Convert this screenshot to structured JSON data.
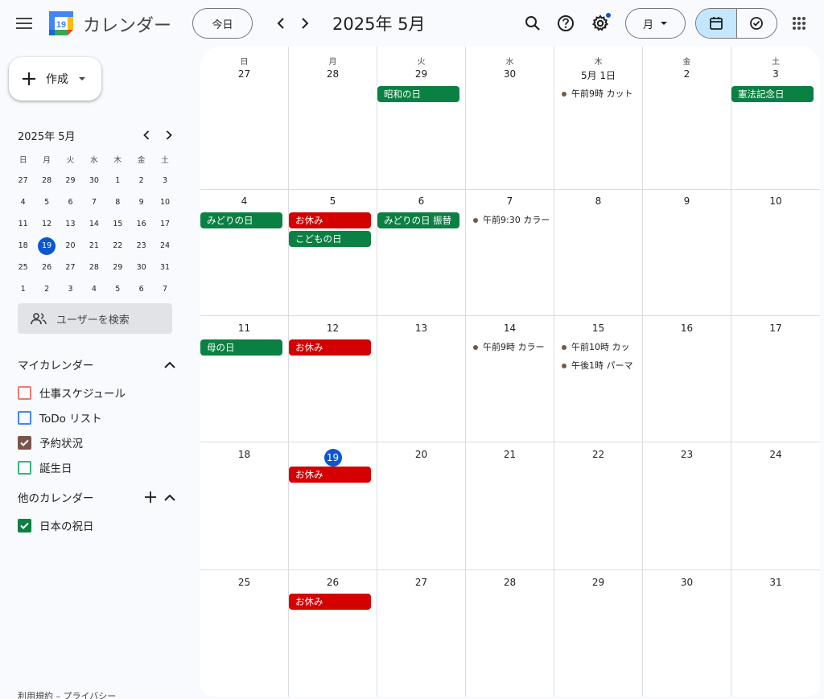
{
  "header": {
    "app_title": "カレンダー",
    "logo_day": "19",
    "today_label": "今日",
    "period_label": "2025年 5月",
    "view_label": "月"
  },
  "sidebar": {
    "create_label": "作成",
    "mini_title": "2025年 5月",
    "weekdays": [
      "日",
      "月",
      "火",
      "水",
      "木",
      "金",
      "土"
    ],
    "mini_days": [
      [
        "27",
        "28",
        "29",
        "30",
        "1",
        "2",
        "3"
      ],
      [
        "4",
        "5",
        "6",
        "7",
        "8",
        "9",
        "10"
      ],
      [
        "11",
        "12",
        "13",
        "14",
        "15",
        "16",
        "17"
      ],
      [
        "18",
        "19",
        "20",
        "21",
        "22",
        "23",
        "24"
      ],
      [
        "25",
        "26",
        "27",
        "28",
        "29",
        "30",
        "31"
      ],
      [
        "1",
        "2",
        "3",
        "4",
        "5",
        "6",
        "7"
      ]
    ],
    "today_day": "19",
    "user_search_label": "ユーザーを検索",
    "my_calendars_title": "マイカレンダー",
    "my_calendars": [
      {
        "label": "仕事スケジュール",
        "color": "#e67c73",
        "checked": false
      },
      {
        "label": "ToDo リスト",
        "color": "#4285f4",
        "checked": false
      },
      {
        "label": "予約状況",
        "color": "#795548",
        "checked": true
      },
      {
        "label": "誕生日",
        "color": "#33b679",
        "checked": false
      }
    ],
    "other_calendars_title": "他のカレンダー",
    "other_calendars": [
      {
        "label": "日本の祝日",
        "color": "#0b8043",
        "checked": true
      }
    ],
    "footer": "利用規約 – プライバシー"
  },
  "month": {
    "weekdays": [
      "日",
      "月",
      "火",
      "水",
      "木",
      "金",
      "土"
    ],
    "weeks": [
      [
        {
          "day": "27",
          "events": []
        },
        {
          "day": "28",
          "events": []
        },
        {
          "day": "29",
          "events": [
            {
              "type": "allday",
              "color": "green",
              "label": "昭和の日"
            }
          ]
        },
        {
          "day": "30",
          "events": []
        },
        {
          "day": "5月 1日",
          "events": [
            {
              "type": "timed",
              "label": "午前9時 カット"
            }
          ]
        },
        {
          "day": "2",
          "events": []
        },
        {
          "day": "3",
          "events": [
            {
              "type": "allday",
              "color": "green",
              "label": "憲法記念日"
            }
          ]
        }
      ],
      [
        {
          "day": "4",
          "events": [
            {
              "type": "allday",
              "color": "green",
              "label": "みどりの日"
            }
          ]
        },
        {
          "day": "5",
          "events": [
            {
              "type": "allday",
              "color": "red",
              "label": "お休み"
            },
            {
              "type": "allday",
              "color": "green",
              "label": "こどもの日"
            }
          ]
        },
        {
          "day": "6",
          "events": [
            {
              "type": "allday",
              "color": "green",
              "label": "みどりの日 振替"
            }
          ]
        },
        {
          "day": "7",
          "events": [
            {
              "type": "timed",
              "label": "午前9:30 カラー"
            }
          ]
        },
        {
          "day": "8",
          "events": []
        },
        {
          "day": "9",
          "events": []
        },
        {
          "day": "10",
          "events": []
        }
      ],
      [
        {
          "day": "11",
          "events": [
            {
              "type": "allday",
              "color": "green",
              "label": "母の日"
            }
          ]
        },
        {
          "day": "12",
          "events": [
            {
              "type": "allday",
              "color": "red",
              "label": "お休み"
            }
          ]
        },
        {
          "day": "13",
          "events": []
        },
        {
          "day": "14",
          "events": [
            {
              "type": "timed",
              "label": "午前9時 カラー"
            }
          ]
        },
        {
          "day": "15",
          "events": [
            {
              "type": "timed",
              "label": "午前10時 カッ"
            },
            {
              "type": "timed",
              "label": "午後1時 パーマ"
            }
          ]
        },
        {
          "day": "16",
          "events": []
        },
        {
          "day": "17",
          "events": []
        }
      ],
      [
        {
          "day": "18",
          "events": []
        },
        {
          "day": "19",
          "today": true,
          "events": [
            {
              "type": "allday",
              "color": "red",
              "label": "お休み"
            }
          ]
        },
        {
          "day": "20",
          "events": []
        },
        {
          "day": "21",
          "events": []
        },
        {
          "day": "22",
          "events": []
        },
        {
          "day": "23",
          "events": []
        },
        {
          "day": "24",
          "events": []
        }
      ],
      [
        {
          "day": "25",
          "events": []
        },
        {
          "day": "26",
          "events": [
            {
              "type": "allday",
              "color": "red",
              "label": "お休み"
            }
          ]
        },
        {
          "day": "27",
          "events": []
        },
        {
          "day": "28",
          "events": []
        },
        {
          "day": "29",
          "events": []
        },
        {
          "day": "30",
          "events": []
        },
        {
          "day": "31",
          "events": []
        }
      ]
    ]
  }
}
